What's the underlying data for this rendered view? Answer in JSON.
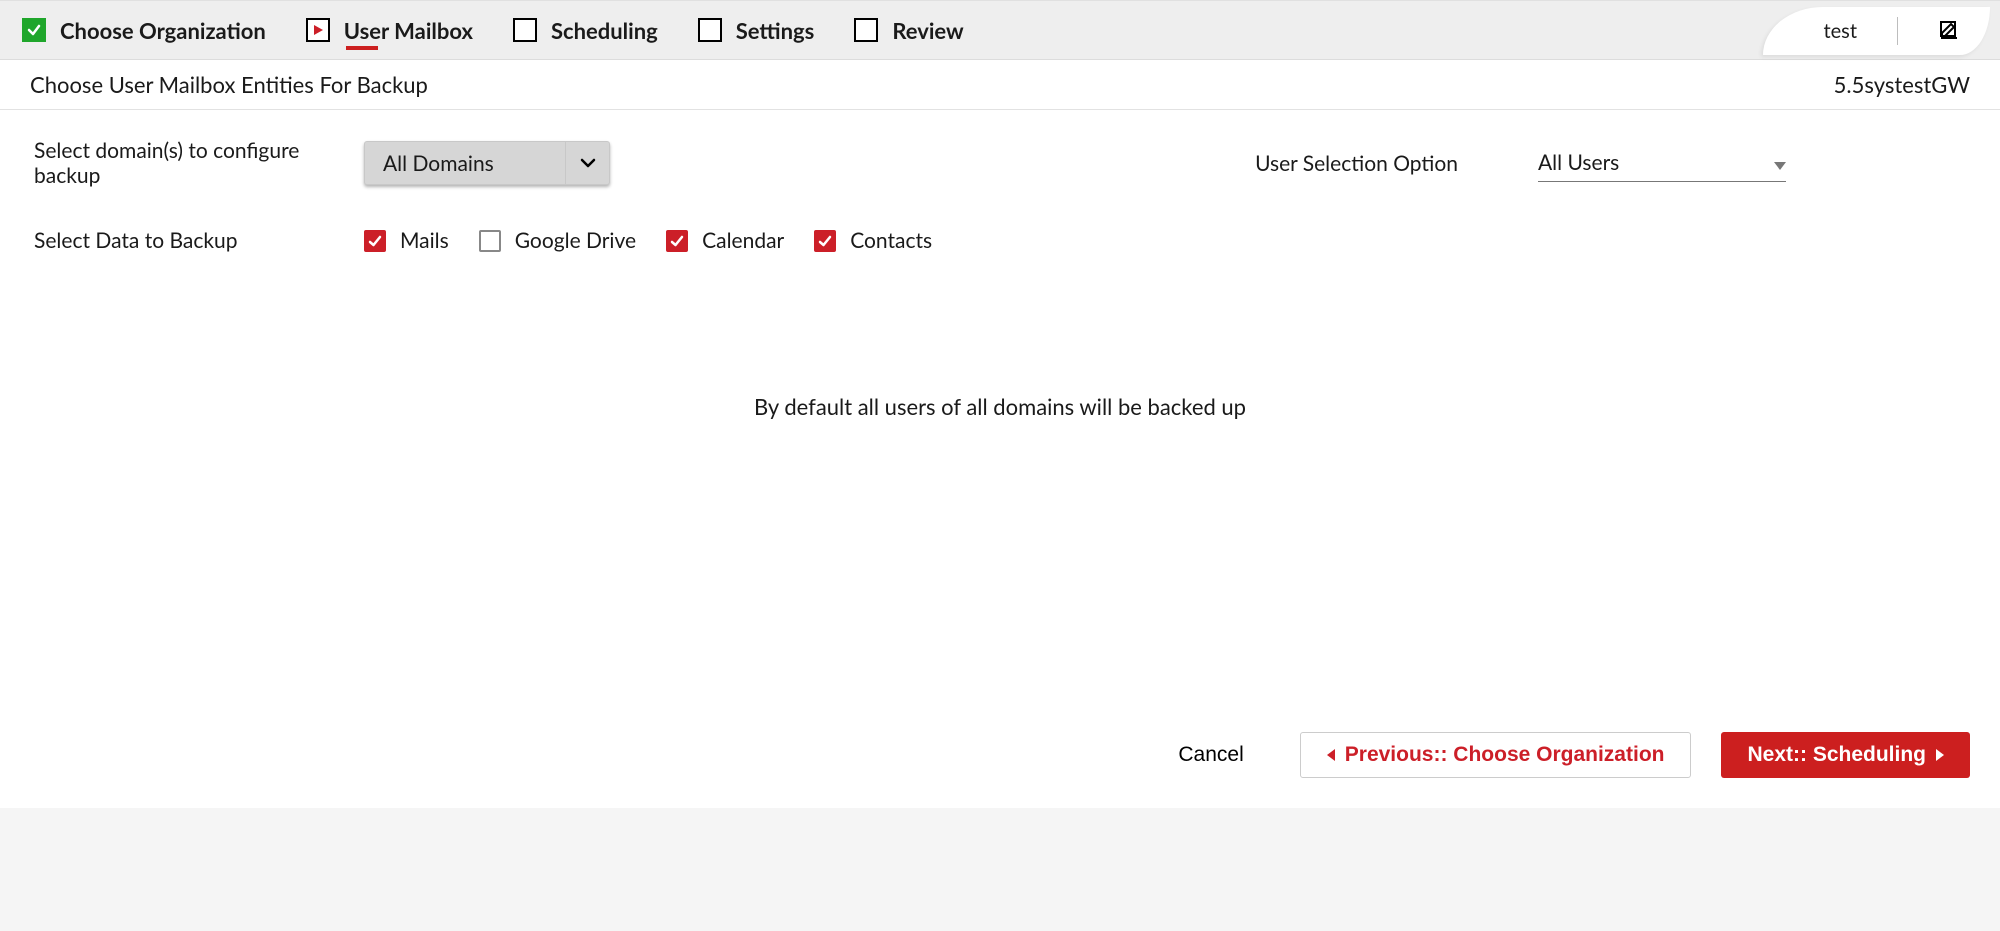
{
  "steps": {
    "choose_org": "Choose Organization",
    "user_mailbox": "User Mailbox",
    "scheduling": "Scheduling",
    "settings": "Settings",
    "review": "Review"
  },
  "right_tab": {
    "name": "test"
  },
  "subheader": {
    "title": "Choose User Mailbox Entities For Backup",
    "instance": "5.5systestGW"
  },
  "form": {
    "domain_label": "Select domain(s) to configure backup",
    "domain_value": "All Domains",
    "user_sel_label": "User Selection Option",
    "user_sel_value": "All Users",
    "data_label": "Select Data to Backup",
    "checks": {
      "mails": "Mails",
      "gdrive": "Google Drive",
      "calendar": "Calendar",
      "contacts": "Contacts"
    },
    "note": "By default all users of all domains will be backed up"
  },
  "footer": {
    "cancel": "Cancel",
    "prev": "Previous:: Choose Organization",
    "next": "Next:: Scheduling"
  }
}
